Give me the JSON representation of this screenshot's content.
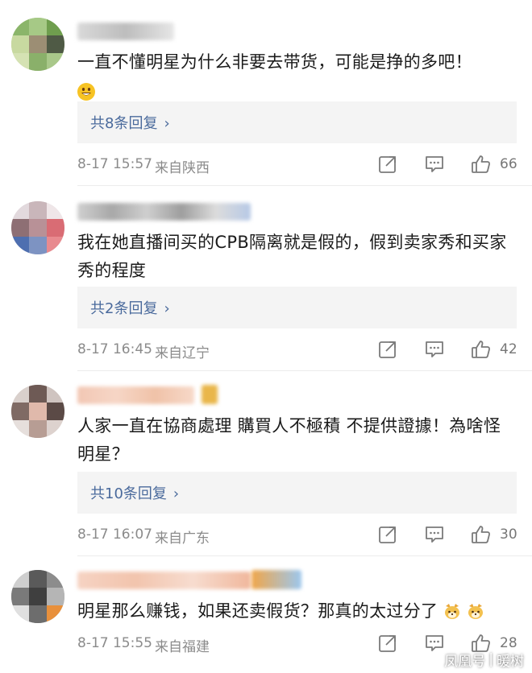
{
  "colors": {
    "reply_link": "#4a6a9c",
    "meta_text": "#8b8b8b",
    "reply_bg": "#f4f4f4",
    "divider": "#ececec"
  },
  "comments": [
    {
      "text": "一直不懂明星为什么非要去带货，可能是挣的多吧！",
      "emoji": "grinning-face-emoji",
      "reply_label": "共8条回复",
      "time": "8-17 15:57",
      "source": "来自陕西",
      "likes": "66"
    },
    {
      "text": "我在她直播间买的CPB隔离就是假的，假到卖家秀和买家秀的程度",
      "reply_label": "共2条回复",
      "time": "8-17 16:45",
      "source": "来自辽宁",
      "likes": "42"
    },
    {
      "text": "人家一直在協商處理 購買人不極積 不提供證據！為啥怪明星？",
      "reply_label": "共10条回复",
      "time": "8-17 16:07",
      "source": "来自广东",
      "likes": "30"
    },
    {
      "text": "明星那么赚钱，如果还卖假货？那真的太过分了",
      "emoji": "dog-face-emoji",
      "time": "8-17 15:55",
      "source": "来自福建",
      "likes": "28"
    }
  ],
  "watermark": {
    "left": "凤凰号",
    "sep": "|",
    "right": "暖树"
  }
}
